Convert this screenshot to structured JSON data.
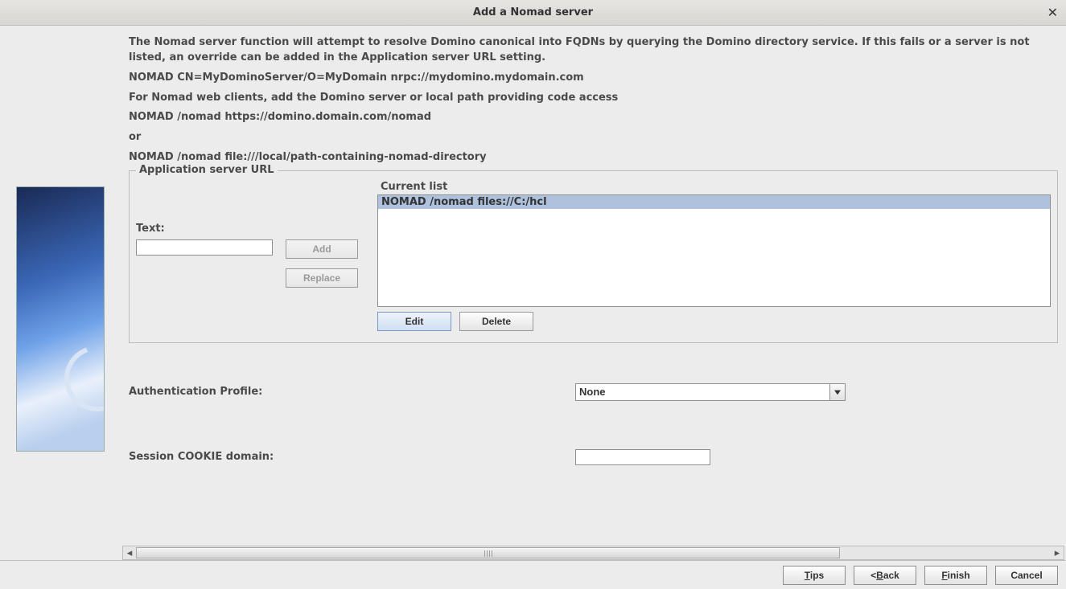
{
  "window": {
    "title": "Add a Nomad server"
  },
  "help": {
    "p1": "The Nomad server function will attempt to resolve Domino canonical into FQDNs by querying the Domino directory service.  If this fails or a server is not listed, an override can be added in the Application server URL setting.",
    "p2": " NOMAD CN=MyDominoServer/O=MyDomain nrpc://mydomino.mydomain.com",
    "p3": "For Nomad web clients, add the Domino server or local path providing code access",
    "p4": " NOMAD /nomad https://domino.domain.com/nomad",
    "p5": "or",
    "p6": " NOMAD /nomad file:///local/path-containing-nomad-directory"
  },
  "appurl": {
    "legend": "Application server URL",
    "text_label": "Text:",
    "text_value": "",
    "add_label": "Add",
    "replace_label": "Replace",
    "current_list_label": "Current list",
    "list": [
      "NOMAD /nomad files://C:/hcl"
    ],
    "selected_index": 0,
    "edit_label": "Edit",
    "delete_label": "Delete"
  },
  "auth": {
    "label": "Authentication Profile:",
    "value": "None"
  },
  "cookie": {
    "label": "Session COOKIE domain:",
    "value": ""
  },
  "footer": {
    "tips": "Tips",
    "back": "Back",
    "finish": "Finish",
    "cancel": "Cancel"
  }
}
